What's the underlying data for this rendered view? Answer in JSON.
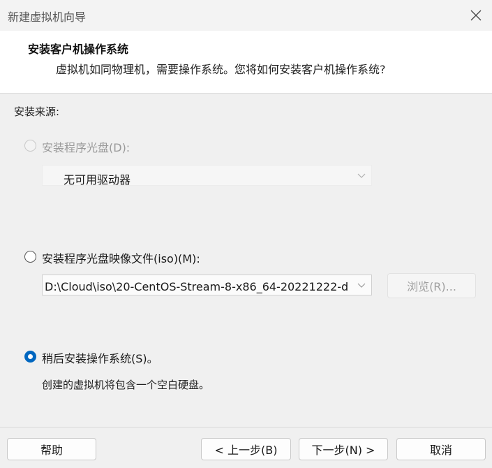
{
  "window": {
    "title": "新建虚拟机向导",
    "close_icon": "close-icon"
  },
  "header": {
    "title": "安装客户机操作系统",
    "description": "虚拟机如同物理机，需要操作系统。您将如何安装客户机操作系统?"
  },
  "install_source": {
    "label": "安装来源:",
    "options": [
      {
        "label": "安装程序光盘(D):",
        "state": "disabled",
        "selected": false,
        "select_value": "无可用驱动器"
      },
      {
        "label": "安装程序光盘映像文件(iso)(M):",
        "state": "enabled",
        "selected": false,
        "select_value": "D:\\Cloud\\iso\\20-CentOS-Stream-8-x86_64-20221222-d",
        "browse_label": "浏览(R)..."
      },
      {
        "label": "稍后安装操作系统(S)。",
        "state": "enabled",
        "selected": true,
        "description": "创建的虚拟机将包含一个空白硬盘。"
      }
    ]
  },
  "footer": {
    "help_label": "帮助",
    "back_label": "< 上一步(B)",
    "next_label": "下一步(N) >",
    "cancel_label": "取消"
  },
  "colors": {
    "accent": "#0067c0",
    "background": "#f0f0f0",
    "header_background": "#ffffff",
    "disabled_text": "#9a9a9a"
  }
}
